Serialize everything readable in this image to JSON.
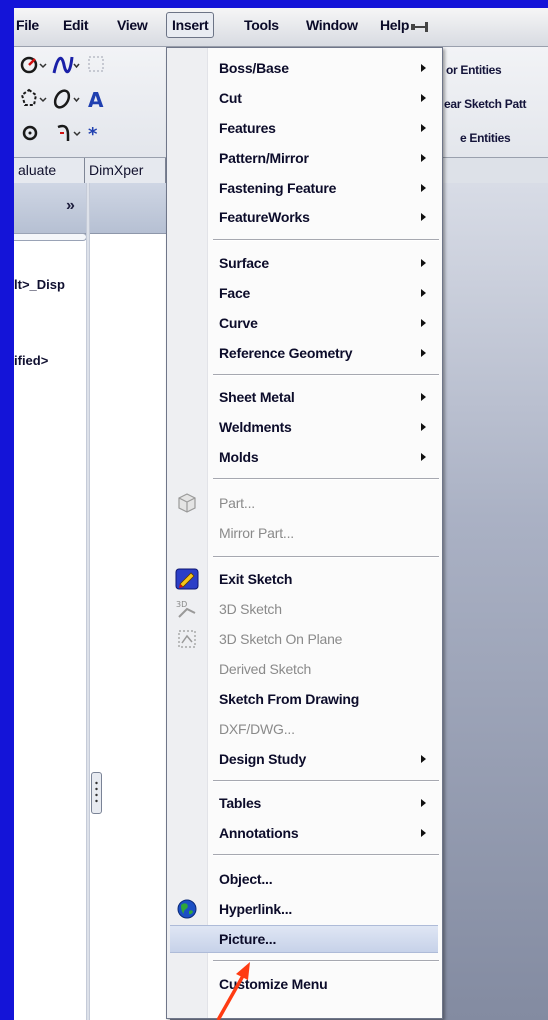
{
  "menubar": {
    "items": [
      "File",
      "Edit",
      "View",
      "Insert",
      "Tools",
      "Window",
      "Help"
    ],
    "open_item": "Insert"
  },
  "toolbar": {
    "right_labels": [
      "or Entities",
      "ear Sketch Patt",
      "e Entities"
    ]
  },
  "tabs": [
    "aluate",
    "DimXper"
  ],
  "panel": {
    "tree_lines": [
      "lt>_Disp",
      "ified>"
    ]
  },
  "dropdown": {
    "groups": [
      [
        {
          "label": "Boss/Base",
          "submenu": true
        },
        {
          "label": "Cut",
          "submenu": true
        },
        {
          "label": "Features",
          "submenu": true
        },
        {
          "label": "Pattern/Mirror",
          "submenu": true
        },
        {
          "label": "Fastening Feature",
          "submenu": true
        },
        {
          "label": "FeatureWorks",
          "submenu": true
        }
      ],
      [
        {
          "label": "Surface",
          "submenu": true
        },
        {
          "label": "Face",
          "submenu": true
        },
        {
          "label": "Curve",
          "submenu": true
        },
        {
          "label": "Reference Geometry",
          "submenu": true
        }
      ],
      [
        {
          "label": "Sheet Metal",
          "submenu": true
        },
        {
          "label": "Weldments",
          "submenu": true
        },
        {
          "label": "Molds",
          "submenu": true
        }
      ],
      [
        {
          "label": "Part...",
          "disabled": true,
          "icon": "part-icon"
        },
        {
          "label": "Mirror Part...",
          "disabled": true
        }
      ],
      [
        {
          "label": "Exit Sketch",
          "icon": "exit-sketch-icon"
        },
        {
          "label": "3D Sketch",
          "disabled": true,
          "icon": "3d-sketch-icon"
        },
        {
          "label": "3D Sketch On Plane",
          "disabled": true,
          "icon": "3d-sketch-on-plane-icon"
        },
        {
          "label": "Derived Sketch",
          "disabled": true
        },
        {
          "label": "Sketch From Drawing"
        },
        {
          "label": "DXF/DWG...",
          "disabled": true
        },
        {
          "label": "Design Study",
          "submenu": true
        }
      ],
      [
        {
          "label": "Tables",
          "submenu": true
        },
        {
          "label": "Annotations",
          "submenu": true
        }
      ],
      [
        {
          "label": "Object..."
        },
        {
          "label": "Hyperlink...",
          "icon": "hyperlink-globe-icon"
        },
        {
          "label": "Picture...",
          "highlighted": true
        }
      ],
      [
        {
          "label": "Customize Menu"
        }
      ]
    ]
  },
  "colors": {
    "background": "#1414d8",
    "annotation_arrow": "#ff3b12",
    "highlight": "#c7d2e9"
  }
}
